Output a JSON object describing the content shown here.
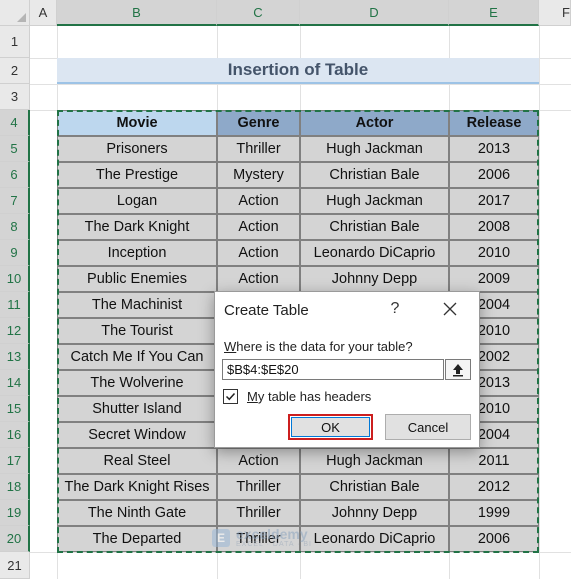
{
  "sheet": {
    "columns": [
      "A",
      "B",
      "C",
      "D",
      "E",
      "F"
    ],
    "rows": [
      "1",
      "2",
      "3",
      "4",
      "5",
      "6",
      "7",
      "8",
      "9",
      "10",
      "11",
      "12",
      "13",
      "14",
      "15",
      "16",
      "17",
      "18",
      "19",
      "20",
      "21"
    ],
    "title": "Insertion of Table",
    "table": {
      "headers": [
        "Movie",
        "Genre",
        "Actor",
        "Release"
      ],
      "rows": [
        [
          "Prisoners",
          "Thriller",
          "Hugh Jackman",
          "2013"
        ],
        [
          "The Prestige",
          "Mystery",
          "Christian Bale",
          "2006"
        ],
        [
          "Logan",
          "Action",
          "Hugh Jackman",
          "2017"
        ],
        [
          "The Dark Knight",
          "Action",
          "Christian Bale",
          "2008"
        ],
        [
          "Inception",
          "Action",
          "Leonardo DiCaprio",
          "2010"
        ],
        [
          "Public Enemies",
          "Action",
          "Johnny Depp",
          "2009"
        ],
        [
          "The Machinist",
          "",
          "",
          "2004"
        ],
        [
          "The Tourist",
          "",
          "",
          "2010"
        ],
        [
          "Catch Me If You Can",
          "",
          "",
          "2002"
        ],
        [
          "The Wolverine",
          "",
          "",
          "2013"
        ],
        [
          "Shutter Island",
          "",
          "",
          "2010"
        ],
        [
          "Secret Window",
          "",
          "",
          "2004"
        ],
        [
          "Real Steel",
          "Action",
          "Hugh Jackman",
          "2011"
        ],
        [
          "The Dark Knight Rises",
          "Thriller",
          "Christian Bale",
          "2012"
        ],
        [
          "The Ninth Gate",
          "Thriller",
          "Johnny Depp",
          "1999"
        ],
        [
          "The Departed",
          "Thriller",
          "Leonardo DiCaprio",
          "2006"
        ]
      ]
    },
    "watermark": {
      "logo": "E",
      "name": "exceldemy",
      "tagline": "EXCEL · DATA · BI"
    }
  },
  "dialog": {
    "title": "Create Table",
    "help": "?",
    "prompt_pre": "",
    "prompt_underlined": "W",
    "prompt_post": "here is the data for your table?",
    "range_value": "$B$4:$E$20",
    "checkbox_checked": true,
    "checkbox_underlined": "M",
    "checkbox_label_post": "y table has headers",
    "ok_label": "OK",
    "cancel_label": "Cancel"
  },
  "colors": {
    "accent": "#217346",
    "ok_highlight": "#cc1f1f",
    "header_fill": "#8ea9c9",
    "cell_fill": "#d4d4d4"
  },
  "icons": {
    "collapse": "upload-arrow-icon",
    "close": "close-icon",
    "check": "checkmark-icon"
  }
}
